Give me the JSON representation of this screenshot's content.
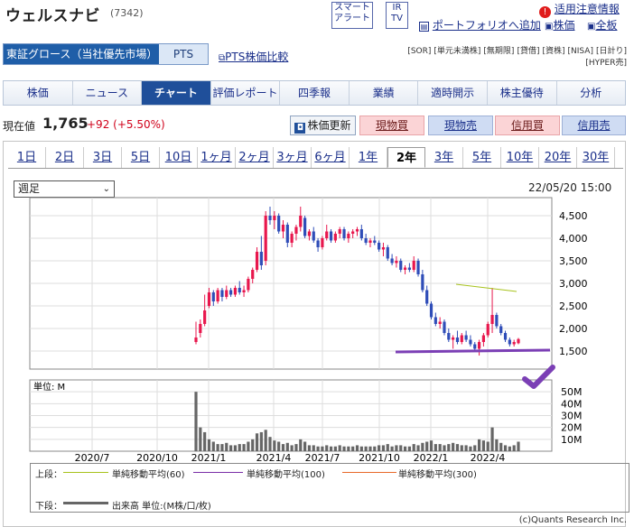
{
  "header": {
    "title": "ウェルスナビ",
    "code": "(7342)",
    "smart_alert": [
      "スマート",
      "アラート"
    ],
    "ir_tv": [
      "IR",
      "TV"
    ],
    "notice": "适用注意情報",
    "portfolio": "ポートフォリオへ追加",
    "stock_price": "株価",
    "board": "全板"
  },
  "market": {
    "name": "東証グロース（当社優先市場）",
    "alt": "PTS"
  },
  "pts_compare": "PTS株価比較",
  "tags": [
    "[SOR]",
    "[単元未満株]",
    "[無期限]",
    "[貸借]",
    "[資株]",
    "[NISA]",
    "[日計り]",
    "[HYPER売]"
  ],
  "tabs": [
    "株価",
    "ニュース",
    "チャート",
    "評価レポート",
    "四季報",
    "業績",
    "適時開示",
    "株主優待",
    "分析"
  ],
  "active_tab": "チャート",
  "quote": {
    "label": "現在値",
    "price": "1,765",
    "change": "+92 (+5.50%)"
  },
  "buttons": {
    "update": "株価更新",
    "spot_buy": "現物買",
    "spot_sell": "現物売",
    "margin_buy": "信用買",
    "margin_sell": "信用売"
  },
  "periods": [
    "1日",
    "2日",
    "3日",
    "5日",
    "10日",
    "1ヶ月",
    "2ヶ月",
    "3ヶ月",
    "6ヶ月",
    "1年",
    "2年",
    "3年",
    "5年",
    "10年",
    "20年",
    "30年"
  ],
  "active_period": "2年",
  "interval": "週足",
  "datetime": "22/05/20 15:00",
  "chart_data": {
    "type": "candlestick",
    "y_ticks": [
      "4,500",
      "4,000",
      "3,500",
      "3,000",
      "2,500",
      "2,000",
      "1,500"
    ],
    "volume_ticks": [
      "50M",
      "40M",
      "30M",
      "20M",
      "10M"
    ],
    "volume_unit": "単位: M",
    "x_ticks": [
      "2020/7",
      "2020/10",
      "2021/1",
      "2021/4",
      "2021/7",
      "2021/10",
      "2022/1",
      "2022/4"
    ],
    "ylim": [
      1100,
      4900
    ],
    "support_line": 1500,
    "ma60": [
      {
        "x": "2022/1",
        "y": 2980
      },
      {
        "x": "2022/4",
        "y": 2820
      }
    ],
    "up_color": "#e8174d",
    "down_color": "#2f4db8",
    "candles": [
      [
        1700,
        2150,
        1650,
        1800
      ],
      [
        1900,
        2200,
        1800,
        2100
      ],
      [
        2100,
        2750,
        2050,
        2400
      ],
      [
        2500,
        2900,
        2450,
        2800
      ],
      [
        2800,
        2850,
        2500,
        2600
      ],
      [
        2600,
        2900,
        2550,
        2850
      ],
      [
        2850,
        2900,
        2600,
        2700
      ],
      [
        2700,
        2950,
        2650,
        2850
      ],
      [
        2850,
        2900,
        2700,
        2750
      ],
      [
        2750,
        2950,
        2700,
        2900
      ],
      [
        2900,
        3050,
        2750,
        2800
      ],
      [
        2800,
        2950,
        2700,
        2850
      ],
      [
        2850,
        3150,
        2800,
        3100
      ],
      [
        3100,
        3350,
        3000,
        3300
      ],
      [
        3300,
        3800,
        3250,
        3700
      ],
      [
        3700,
        4050,
        3300,
        3400
      ],
      [
        3500,
        4600,
        3400,
        4500
      ],
      [
        4500,
        4700,
        4300,
        4400
      ],
      [
        4400,
        4600,
        4200,
        4500
      ],
      [
        4500,
        4550,
        4100,
        4150
      ],
      [
        4150,
        4400,
        4000,
        4300
      ],
      [
        4300,
        4350,
        3800,
        3900
      ],
      [
        3900,
        4150,
        3800,
        4100
      ],
      [
        4100,
        4300,
        3950,
        4250
      ],
      [
        4250,
        4700,
        4150,
        4500
      ],
      [
        4450,
        4500,
        4000,
        4050
      ],
      [
        4050,
        4200,
        3950,
        4150
      ],
      [
        4150,
        4250,
        3900,
        3950
      ],
      [
        3950,
        4000,
        3700,
        3800
      ],
      [
        3800,
        4050,
        3750,
        4000
      ],
      [
        4000,
        4300,
        3950,
        4150
      ],
      [
        4150,
        4200,
        3900,
        3950
      ],
      [
        3950,
        4150,
        3900,
        4100
      ],
      [
        4100,
        4250,
        4000,
        4200
      ],
      [
        4200,
        4250,
        3950,
        4000
      ],
      [
        4000,
        4150,
        3900,
        4100
      ],
      [
        4100,
        4200,
        4000,
        4150
      ],
      [
        4150,
        4250,
        4050,
        4200
      ],
      [
        4200,
        4300,
        3950,
        4000
      ],
      [
        4000,
        4100,
        3850,
        3900
      ],
      [
        3900,
        4000,
        3800,
        3950
      ],
      [
        3950,
        4050,
        3850,
        3900
      ],
      [
        3900,
        3950,
        3700,
        3750
      ],
      [
        3750,
        3900,
        3600,
        3800
      ],
      [
        3800,
        3850,
        3500,
        3550
      ],
      [
        3550,
        3650,
        3400,
        3450
      ],
      [
        3450,
        3600,
        3350,
        3500
      ],
      [
        3500,
        3550,
        3250,
        3300
      ],
      [
        3300,
        3400,
        3200,
        3350
      ],
      [
        3350,
        3450,
        3250,
        3300
      ],
      [
        3300,
        3600,
        3250,
        3500
      ],
      [
        3500,
        3550,
        3150,
        3200
      ],
      [
        3200,
        3300,
        2800,
        2850
      ],
      [
        2850,
        2950,
        2500,
        2550
      ],
      [
        2550,
        2600,
        2200,
        2250
      ],
      [
        2250,
        2350,
        2050,
        2100
      ],
      [
        2100,
        2250,
        2000,
        2150
      ],
      [
        2150,
        2200,
        1850,
        1900
      ],
      [
        1900,
        2000,
        1700,
        1750
      ],
      [
        1750,
        1850,
        1550,
        1800
      ],
      [
        1800,
        1950,
        1650,
        1700
      ],
      [
        1700,
        1900,
        1650,
        1850
      ],
      [
        1850,
        1950,
        1700,
        1750
      ],
      [
        1750,
        1850,
        1600,
        1650
      ],
      [
        1650,
        1700,
        1500,
        1550
      ],
      [
        1550,
        1750,
        1400,
        1700
      ],
      [
        1700,
        1900,
        1600,
        1850
      ],
      [
        1850,
        2150,
        1800,
        2100
      ],
      [
        2100,
        2900,
        1900,
        2300
      ],
      [
        2300,
        2350,
        2000,
        2050
      ],
      [
        2050,
        2100,
        1850,
        1900
      ],
      [
        1900,
        1950,
        1700,
        1750
      ],
      [
        1750,
        1800,
        1600,
        1650
      ],
      [
        1650,
        1750,
        1600,
        1700
      ],
      [
        1673,
        1790,
        1650,
        1765
      ]
    ],
    "volumes": [
      50,
      20,
      16,
      10,
      8,
      6,
      6,
      7,
      5,
      5,
      6,
      6,
      8,
      10,
      15,
      16,
      18,
      12,
      9,
      8,
      6,
      7,
      5,
      6,
      10,
      8,
      5,
      5,
      4,
      4,
      5,
      4,
      4,
      5,
      4,
      4,
      4,
      5,
      4,
      4,
      4,
      4,
      5,
      5,
      6,
      4,
      5,
      5,
      4,
      4,
      6,
      5,
      7,
      8,
      9,
      6,
      6,
      5,
      6,
      7,
      6,
      5,
      5,
      4,
      5,
      10,
      9,
      8,
      20,
      10,
      7,
      5,
      4,
      5,
      8
    ]
  },
  "legend": {
    "upper_label": "上段：",
    "lower_label": "下段：",
    "ma60": "単純移動平均(60)",
    "ma100": "単純移動平均(100)",
    "ma300": "単純移動平均(300)",
    "volume": "出来高 単位:(M株/口/枚)",
    "ma60_color": "#a7c21c",
    "ma100_color": "#7a2fa8",
    "ma300_color": "#e86a2a"
  },
  "copyright": "(c)Quants Research Inc.",
  "annotation": {
    "line_color": "#7b3fb5",
    "check_color": "#7b3fb5"
  }
}
